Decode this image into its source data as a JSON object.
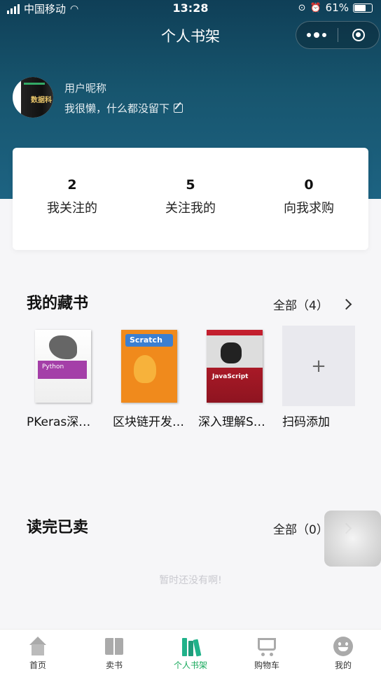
{
  "status_bar": {
    "carrier": "中国移动",
    "time": "13:28",
    "battery": "61%",
    "battery_level": 0.61
  },
  "nav": {
    "title": "个人书架"
  },
  "profile": {
    "nickname": "用户昵称",
    "bio": "我很懒，什么都没留下",
    "avatar_text": "数据科"
  },
  "stats": [
    {
      "value": "2",
      "label": "我关注的"
    },
    {
      "value": "5",
      "label": "关注我的"
    },
    {
      "value": "0",
      "label": "向我求购"
    }
  ],
  "collection": {
    "title": "我的藏书",
    "all_label": "全部（4）",
    "books": [
      {
        "title": "PKeras深度学习",
        "cover_text": "Python",
        "cover": "python"
      },
      {
        "title": "区块链开发实战",
        "cover_text": "Scratch",
        "cover": "scratch"
      },
      {
        "title": "深入理解Spring",
        "cover_text": "JavaScript",
        "cover": "js"
      }
    ],
    "add_label": "扫码添加",
    "add_icon": "+"
  },
  "sold": {
    "title": "读完已卖",
    "all_label": "全部（0）",
    "empty_text": "暂时还没有啊!"
  },
  "tabbar": [
    {
      "label": "首页",
      "icon": "home-icon"
    },
    {
      "label": "卖书",
      "icon": "book-icon"
    },
    {
      "label": "个人书架",
      "icon": "bookshelf-icon",
      "active": true
    },
    {
      "label": "购物车",
      "icon": "cart-icon"
    },
    {
      "label": "我的",
      "icon": "smile-icon"
    }
  ],
  "colors": {
    "header": "#17556e",
    "active_tab": "#15a85a"
  }
}
